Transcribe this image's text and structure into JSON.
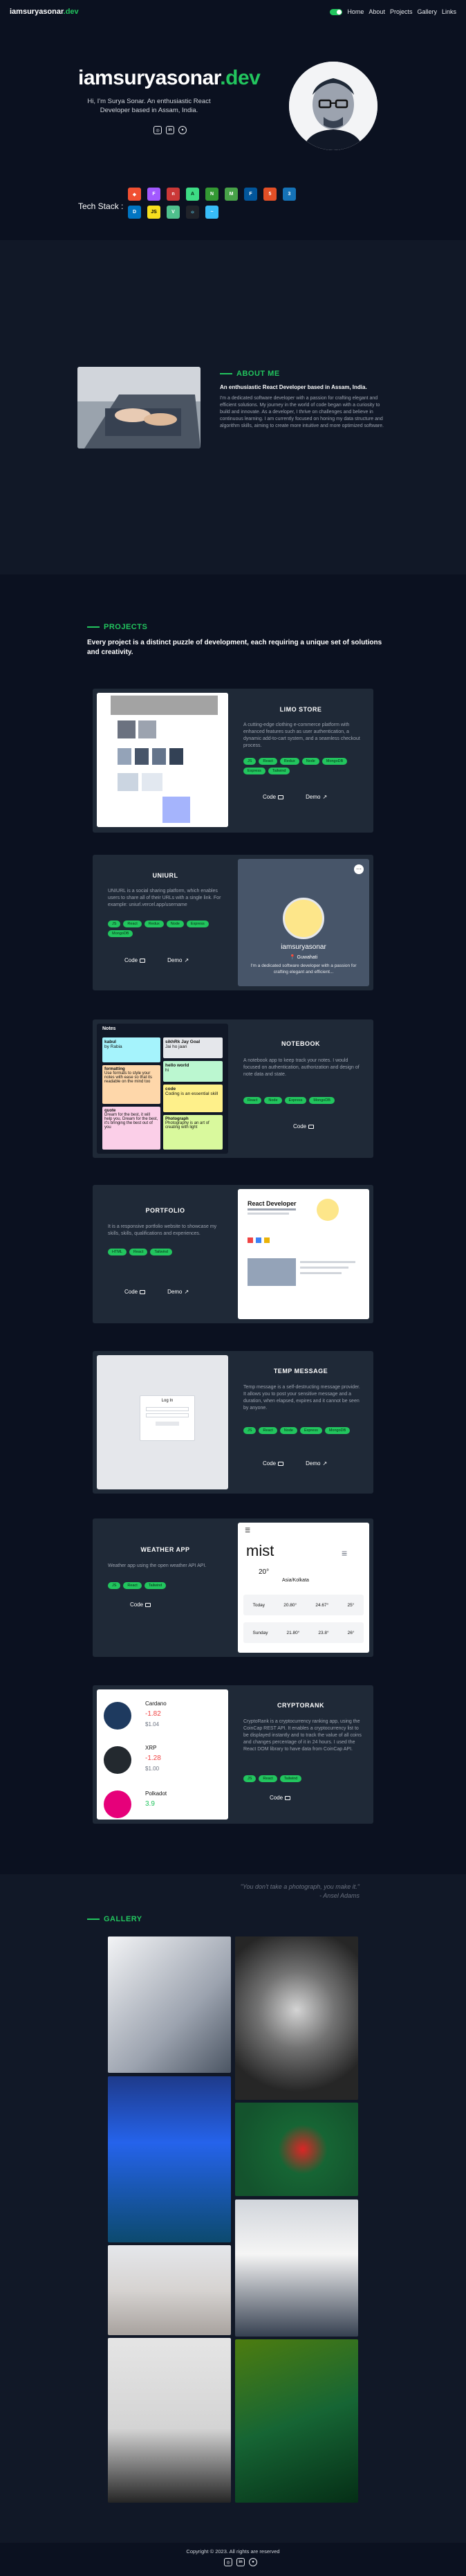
{
  "nav": {
    "brand_main": "iamsuryasonar",
    "brand_tld": ".dev",
    "links": [
      "Home",
      "About",
      "Projects",
      "Gallery",
      "Links"
    ]
  },
  "hero": {
    "title_main": "iamsuryasonar",
    "title_tld": ".dev",
    "subtitle": "Hi, I'm Surya Sonar. An enthusiastic React Developer based in Assam, India.",
    "tech_label": "Tech Stack :",
    "social_icons": [
      "instagram-icon",
      "linkedin-icon",
      "github-icon"
    ]
  },
  "about": {
    "heading": "ABOUT ME",
    "lead": "An enthusiastic React Developer based in Assam, India.",
    "body": "I'm a dedicated software developer with a passion for crafting elegant and efficient solutions. My journey in the world of code began with a curiosity to build and innovate. As a developer, I thrive on challenges and believe in continuous learning. I am currently focused on honing my data structure and algorithm skills, aiming to create more intuitive and more optimized software."
  },
  "projects": {
    "heading": "PROJECTS",
    "intro": "Every project is a distinct puzzle of development, each requiring a unique set of solutions and creativity.",
    "items": [
      {
        "title": "LIMO STORE",
        "description": "A cutting-edge clothing e-commerce platform with enhanced features such as user authentication, a dynamic add-to-cart system, and a seamless checkout process.",
        "tags": [
          "JS",
          "React",
          "Redux",
          "Node",
          "MongoDB",
          "Express",
          "Tailwind"
        ],
        "buttons": [
          "Code",
          "Demo"
        ]
      },
      {
        "title": "UNIURL",
        "description": "UNIURL is a social sharing platform, which enables users to share all of their URLs with a single link. For example: uniurl.vercel.app/username",
        "tags": [
          "JS",
          "React",
          "Redux",
          "Node",
          "Express",
          "MongoDB"
        ],
        "buttons": [
          "Code",
          "Demo"
        ],
        "profile_name": "iamsuryasonar",
        "profile_location": "Guwahati",
        "profile_bio": "I'm a dedicated software developer with a passion for crafting elegant and efficient..."
      },
      {
        "title": "NOTEBOOK",
        "description": "A notebook app to keep track your notes. I would focused on authentication, authorization and design of note data and state.",
        "tags": [
          "React",
          "Node",
          "Express",
          "MongoDB"
        ],
        "buttons": [
          "Code"
        ],
        "notes_app": "Notes",
        "notes": [
          {
            "title": "kabul",
            "body": "by Rabia"
          },
          {
            "title": "sikhRk Jay Goal",
            "body": "Jai ho jaan"
          },
          {
            "title": "formatting",
            "body": "Use formats to style your notes with ease so that its readable on the mind too"
          },
          {
            "title": "hello world",
            "body": "hi"
          },
          {
            "title": "code",
            "body": "Coding is an essential skill"
          },
          {
            "title": "quote",
            "body": "Dream for the best, it will help you. Dream for the best, it's bringing the best out of you"
          },
          {
            "title": "Photograph",
            "body": "Photography is an art of creating with light"
          }
        ]
      },
      {
        "title": "PORTFOLIO",
        "description": "It is a responsive portfolio website to showcase my skills, skills, qualifications and experiences.",
        "tags": [
          "HTML",
          "React",
          "Tailwind"
        ],
        "buttons": [
          "Code",
          "Demo"
        ],
        "preview_title": "React Developer"
      },
      {
        "title": "TEMP MESSAGE",
        "description": "Temp message is a self-destructing message provider. It allows you to post your sensitive message and a duration, when elapsed, expires and it cannot be seen by anyone.",
        "tags": [
          "JS",
          "React",
          "Node",
          "Express",
          "MongoDB"
        ],
        "buttons": [
          "Code",
          "Demo"
        ],
        "login_title": "Log In"
      },
      {
        "title": "WEATHER APP",
        "description": "Weather app using the open weather API API.",
        "tags": [
          "JS",
          "React",
          "Tailwind"
        ],
        "buttons": [
          "Code"
        ],
        "weather": {
          "condition": "mist",
          "temp": "20°",
          "city": "Asia/Kolkata",
          "rows": [
            {
              "day": "Today",
              "c1": "20.80°",
              "c2": "24.67°",
              "c3": "25°"
            },
            {
              "day": "Sunday",
              "c1": "21.80°",
              "c2": "23.8°",
              "c3": "26°"
            }
          ]
        }
      },
      {
        "title": "CRYPTORANK",
        "description": "CryptoRank is a cryptocurrency ranking app, using the CoinCap REST API. It enables a cryptocurrency list to be displayed instantly and to track the value of all coins and changes percentage of it in 24 hours. I used the React DOM library to have data from CoinCap API.",
        "tags": [
          "JS",
          "React",
          "Tailwind"
        ],
        "buttons": [
          "Code"
        ],
        "coins": [
          {
            "name": "Cardano",
            "change": "-1.82",
            "price": "$1.04"
          },
          {
            "name": "XRP",
            "change": "-1.28",
            "price": "$1.00"
          },
          {
            "name": "Polkadot",
            "change": "3.9",
            "price": ""
          }
        ]
      }
    ]
  },
  "gallery": {
    "heading": "GALLERY",
    "quote": "\"You don't take a photograph, you make it.\"",
    "quote_author": "- Ansel Adams"
  },
  "footer": {
    "copyright": "Copyright © 2023. All rights are reserved"
  },
  "colors": {
    "accent": "#22c55e",
    "bg_dark": "#0b1120",
    "bg_section": "#111827",
    "card": "#1f2937"
  }
}
